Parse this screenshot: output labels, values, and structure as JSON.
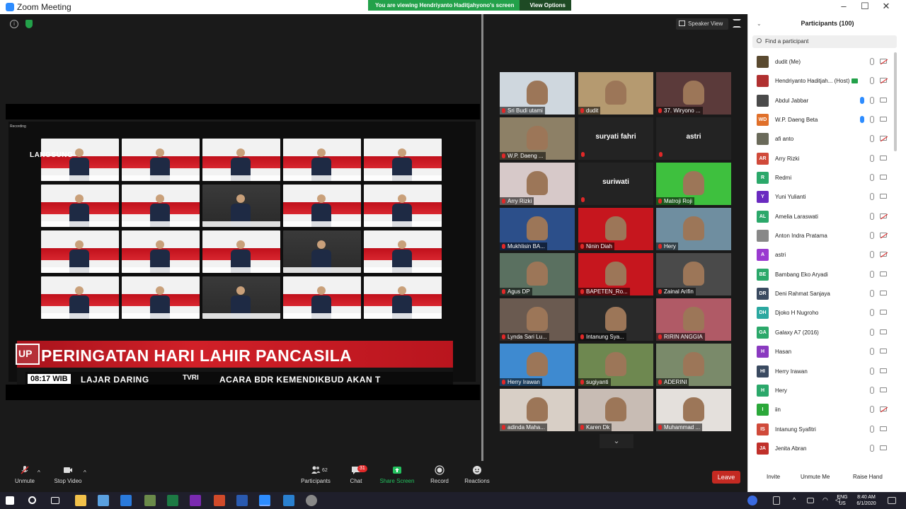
{
  "window": {
    "title": "Zoom Meeting",
    "banner_text": "You are viewing Hendriyanto Haditjahyono's screen",
    "view_options": "View Options"
  },
  "shared": {
    "rec_label": "Recording",
    "langsung": "LANGSUNG",
    "up_badge": "UP",
    "headline": "PERINGATAN HARI LAHIR PANCASILA",
    "time": "08:17 WIB",
    "ticker_a": "LAJAR DARING",
    "tvri": "TVRI",
    "ticker_b": "ACARA BDR KEMENDIKBUD AKAN T"
  },
  "view": {
    "speaker_view": "Speaker View"
  },
  "gallery": [
    {
      "name": "Sri Budi utami",
      "bg": "#cfd7de"
    },
    {
      "name": "dudit",
      "bg": "#b59a70"
    },
    {
      "name": "37. Wiryono ...",
      "bg": "#5b3a3a"
    },
    {
      "name": "W.P. Daeng ...",
      "bg": "#8d8066"
    },
    {
      "name": "suryati fahri",
      "bg": ""
    },
    {
      "name": "astri",
      "bg": ""
    },
    {
      "name": "Arry Rizki",
      "bg": "#d7c9c9"
    },
    {
      "name": "suriwati",
      "bg": ""
    },
    {
      "name": "Matroji Roji",
      "bg": "#3ec03e"
    },
    {
      "name": "Mukhlisin BA...",
      "bg": "#2c4f8a"
    },
    {
      "name": "Ninin Diah",
      "bg": "#c6161e"
    },
    {
      "name": "Hery",
      "bg": "#6f8ea0"
    },
    {
      "name": "Agus DP",
      "bg": "#5a7060"
    },
    {
      "name": "BAPETEN_Ro...",
      "bg": "#c6161e"
    },
    {
      "name": "Zainal Arifin",
      "bg": "#4a4a4a"
    },
    {
      "name": "Lynda Sari Lu...",
      "bg": "#6a5a50"
    },
    {
      "name": "Intanung Sya...",
      "bg": "#2a2a2a"
    },
    {
      "name": "RIRIN ANGGIA",
      "bg": "#b05a66"
    },
    {
      "name": "Herry Irawan",
      "bg": "#3e8ad0"
    },
    {
      "name": "sugiyanti",
      "bg": "#6e8850"
    },
    {
      "name": "ADERINI",
      "bg": "#7a8a6a"
    },
    {
      "name": "adinda Maha...",
      "bg": "#d8cfc6"
    },
    {
      "name": "Karen Dk",
      "bg": "#c8bcb4"
    },
    {
      "name": "Muhammad ...",
      "bg": "#e4e0dc"
    }
  ],
  "toolbar": {
    "unmute": "Unmute",
    "stop_video": "Stop Video",
    "participants": "Participants",
    "participants_count": "62",
    "chat": "Chat",
    "chat_count": "31",
    "share_screen": "Share Screen",
    "record": "Record",
    "reactions": "Reactions",
    "leave": "Leave"
  },
  "panel": {
    "title": "Participants (100)",
    "search_placeholder": "Find a participant",
    "invite": "Invite",
    "unmute_me": "Unmute Me",
    "raise_hand": "Raise Hand",
    "participants": [
      {
        "name": "dudit (Me)",
        "initials": "",
        "color": "#5a4a30",
        "cam_off": true,
        "talking": false
      },
      {
        "name": "Hendriyanto Haditjah... (Host)",
        "initials": "",
        "color": "#b03030",
        "cam_off": true,
        "talking": false,
        "host": true
      },
      {
        "name": "Abdul Jabbar",
        "initials": "",
        "color": "#4a4a4a",
        "cam_off": false,
        "talking": true
      },
      {
        "name": "W.P. Daeng Beta",
        "initials": "WD",
        "color": "#e0702a",
        "cam_off": false,
        "talking": true
      },
      {
        "name": "afi anto",
        "initials": "",
        "color": "#6a6a5a",
        "cam_off": true,
        "talking": false
      },
      {
        "name": "Arry Rizki",
        "initials": "AR",
        "color": "#d04a3a",
        "cam_off": false,
        "talking": false
      },
      {
        "name": "Redmi",
        "initials": "R",
        "color": "#2ba86a",
        "cam_off": false,
        "talking": false
      },
      {
        "name": "Yuni Yulianti",
        "initials": "Y",
        "color": "#6a2ac0",
        "cam_off": false,
        "talking": false
      },
      {
        "name": "Amelia Laraswati",
        "initials": "AL",
        "color": "#2ba86a",
        "cam_off": true,
        "talking": false
      },
      {
        "name": "Anton Indra Pratama",
        "initials": "",
        "color": "#888888",
        "cam_off": true,
        "talking": false
      },
      {
        "name": "astri",
        "initials": "A",
        "color": "#9a3ad0",
        "cam_off": true,
        "talking": false
      },
      {
        "name": "Bambang Eko Aryadi",
        "initials": "BE",
        "color": "#2ba86a",
        "cam_off": false,
        "talking": false
      },
      {
        "name": "Deni Rahmat Sanjaya",
        "initials": "DR",
        "color": "#3a4a60",
        "cam_off": false,
        "talking": false
      },
      {
        "name": "Djoko H Nugroho",
        "initials": "DH",
        "color": "#2ba8a0",
        "cam_off": false,
        "talking": false
      },
      {
        "name": "Galaxy A7 (2016)",
        "initials": "GA",
        "color": "#2ba86a",
        "cam_off": false,
        "talking": false
      },
      {
        "name": "Hasan",
        "initials": "H",
        "color": "#8a3ac0",
        "cam_off": false,
        "talking": false
      },
      {
        "name": "Herry Irawan",
        "initials": "HI",
        "color": "#3a4a60",
        "cam_off": false,
        "talking": false
      },
      {
        "name": "Hery",
        "initials": "H",
        "color": "#2ba86a",
        "cam_off": false,
        "talking": false
      },
      {
        "name": "iin",
        "initials": "I",
        "color": "#2ba83a",
        "cam_off": true,
        "talking": false
      },
      {
        "name": "Intanung Syafitri",
        "initials": "IS",
        "color": "#d04a3a",
        "cam_off": false,
        "talking": false
      },
      {
        "name": "Jenita Abran",
        "initials": "JA",
        "color": "#c0302a",
        "cam_off": false,
        "talking": false
      }
    ]
  },
  "taskbar": {
    "lang_top": "ENG",
    "lang_bottom": "US",
    "time": "8:40 AM",
    "date": "6/1/2020"
  }
}
